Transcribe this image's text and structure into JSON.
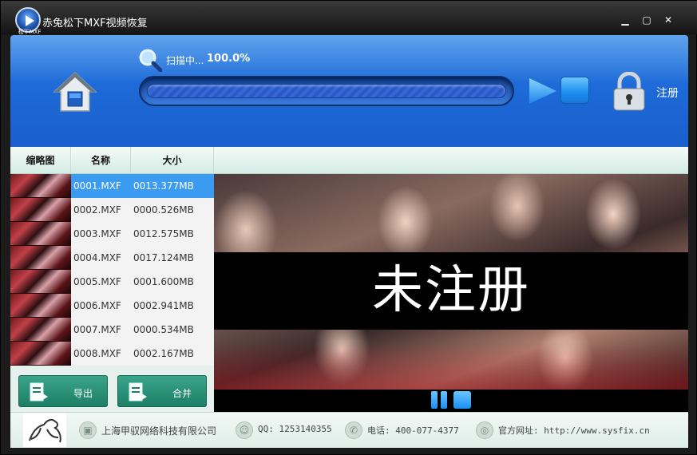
{
  "window": {
    "title": "赤兔松下MXF视频恢复",
    "logo_text": "松下MXF",
    "controls": {
      "minimize": "▁",
      "maximize": "▢",
      "close": "✕"
    }
  },
  "header": {
    "scan_label": "扫描中...",
    "scan_percent": "100.0%",
    "progress": 1.0,
    "register_label": "注册"
  },
  "columns": [
    "缩略图",
    "名称",
    "大小"
  ],
  "files": [
    {
      "name": "0001.MXF",
      "size": "0013.377MB",
      "selected": true
    },
    {
      "name": "0002.MXF",
      "size": "0000.526MB",
      "selected": false
    },
    {
      "name": "0003.MXF",
      "size": "0012.575MB",
      "selected": false
    },
    {
      "name": "0004.MXF",
      "size": "0017.124MB",
      "selected": false
    },
    {
      "name": "0005.MXF",
      "size": "0001.600MB",
      "selected": false
    },
    {
      "name": "0006.MXF",
      "size": "0002.941MB",
      "selected": false
    },
    {
      "name": "0007.MXF",
      "size": "0000.534MB",
      "selected": false
    },
    {
      "name": "0008.MXF",
      "size": "0002.167MB",
      "selected": false
    }
  ],
  "actions": {
    "export_label": "导出",
    "merge_label": "合并"
  },
  "video": {
    "watermark": "未注册"
  },
  "footer": {
    "company": "上海甲驭网络科技有限公司",
    "qq": "QQ: 1253140355",
    "phone": "电话: 400-077-4377",
    "website": "官方网址: http://www.sysfix.cn"
  },
  "colors": {
    "accent": "#1d6ad8",
    "selected_row": "#3a9bf0",
    "button_green": "#1d7e66"
  }
}
